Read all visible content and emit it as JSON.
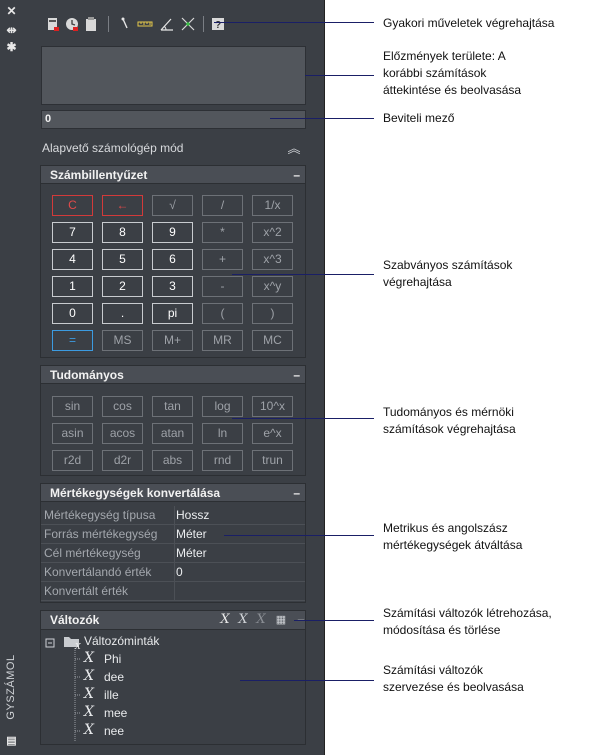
{
  "palette_title": "GYSZÁMOL",
  "mode_label": "Alapvető számológép mód",
  "input_value": "0",
  "toolbar_icons": [
    "clear-icon",
    "history-clear-icon",
    "paste-icon",
    "pick-point-icon",
    "distance-icon",
    "angle-icon",
    "intersection-icon",
    "help-icon"
  ],
  "numpad": {
    "header": "Számbillentyűzet",
    "rows": [
      [
        "C",
        "←",
        "√",
        "/",
        "1/x"
      ],
      [
        "7",
        "8",
        "9",
        "*",
        "x^2"
      ],
      [
        "4",
        "5",
        "6",
        "+",
        "x^3"
      ],
      [
        "1",
        "2",
        "3",
        "-",
        "x^y"
      ],
      [
        "0",
        ".",
        "pi",
        "(",
        ")"
      ],
      [
        "=",
        "MS",
        "M+",
        "MR",
        "MC"
      ]
    ]
  },
  "scientific": {
    "header": "Tudományos",
    "rows": [
      [
        "sin",
        "cos",
        "tan",
        "log",
        "10^x"
      ],
      [
        "asin",
        "acos",
        "atan",
        "ln",
        "e^x"
      ],
      [
        "r2d",
        "d2r",
        "abs",
        "rnd",
        "trun"
      ]
    ]
  },
  "units": {
    "header": "Mértékegységek konvertálása",
    "rows": [
      {
        "label": "Mértékegység típusa",
        "value": "Hossz"
      },
      {
        "label": "Forrás mértékegység",
        "value": "Méter"
      },
      {
        "label": "Cél mértékegység",
        "value": "Méter"
      },
      {
        "label": "Konvertálandó érték",
        "value": "0"
      },
      {
        "label": "Konvertált érték",
        "value": ""
      }
    ]
  },
  "variables": {
    "header": "Változók",
    "group": "Változóminták",
    "items": [
      "Phi",
      "dee",
      "ille",
      "mee",
      "nee"
    ]
  },
  "callouts": [
    [
      "Gyakori műveletek végrehajtása"
    ],
    [
      "Előzmények területe: A",
      "korábbi számítások",
      "áttekintése és beolvasása"
    ],
    [
      "Beviteli mező"
    ],
    [
      "Szabványos számítások",
      "végrehajtása"
    ],
    [
      "Tudományos és mérnöki",
      "számítások végrehajtása"
    ],
    [
      "Metrikus és angolszász",
      "mértékegységek átváltása"
    ],
    [
      "Számítási változók létrehozása,",
      "módosítása és törlése"
    ],
    [
      "Számítási változók",
      "szervezése és beolvasása"
    ]
  ]
}
